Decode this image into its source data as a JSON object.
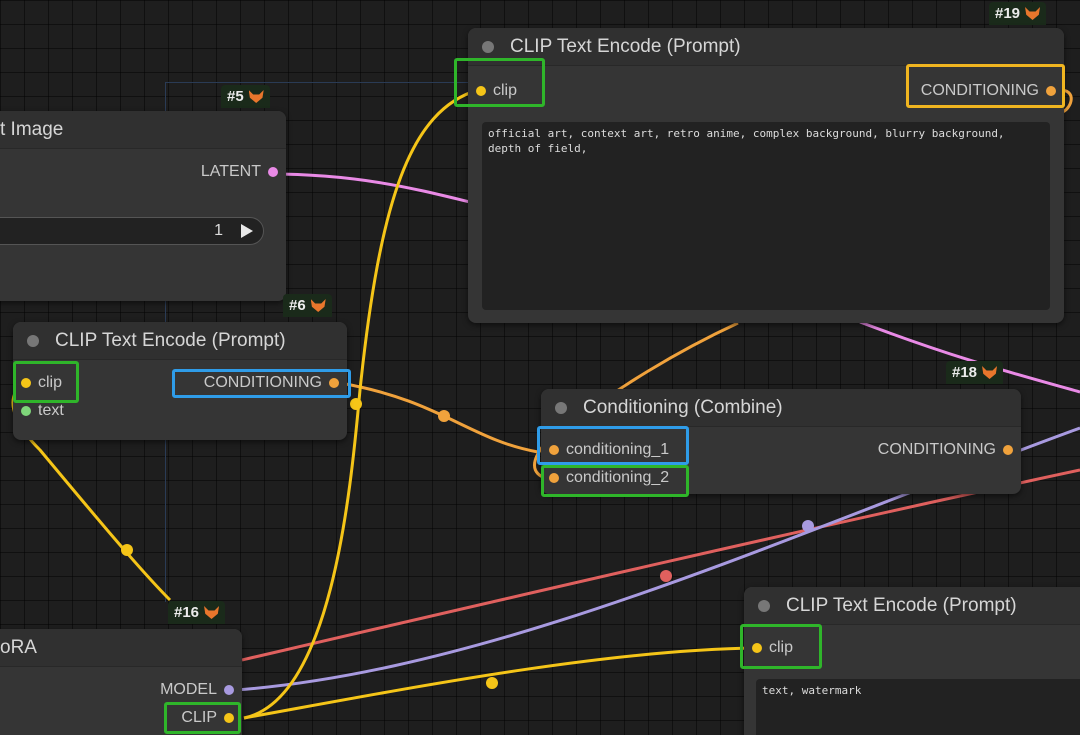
{
  "nodes": {
    "latent_image": {
      "badge": "#5",
      "title": "t Image",
      "output_label": "LATENT",
      "batch_value": "1"
    },
    "clip_encode_6": {
      "badge": "#6",
      "title": "CLIP Text Encode (Prompt)",
      "inputs": [
        "clip",
        "text"
      ],
      "output_label": "CONDITIONING"
    },
    "clip_encode_19": {
      "badge": "#19",
      "title": "CLIP Text Encode (Prompt)",
      "input": "clip",
      "output_label": "CONDITIONING",
      "text": "official art, context art, retro anime, complex background, blurry background, depth of field,"
    },
    "conditioning_combine_18": {
      "badge": "#18",
      "title": "Conditioning (Combine)",
      "inputs": [
        "conditioning_1",
        "conditioning_2"
      ],
      "output_label": "CONDITIONING"
    },
    "lora_16": {
      "badge": "#16",
      "title": "oRA",
      "outputs": [
        "MODEL",
        "CLIP"
      ]
    },
    "clip_encode_neg": {
      "title": "CLIP Text Encode (Prompt)",
      "input": "clip",
      "text": "text, watermark"
    }
  },
  "colors": {
    "clip_wire": "#f5c518",
    "conditioning_wire": "#f0a23c",
    "latent_wire": "#e98ae6",
    "model_wire": "#a89ae0",
    "vae_wire": "#e0605e",
    "highlight_green": "#2fb52a",
    "highlight_blue": "#2f9ce8",
    "highlight_yellow": "#f0b520",
    "badge_icon": "fox-icon"
  }
}
